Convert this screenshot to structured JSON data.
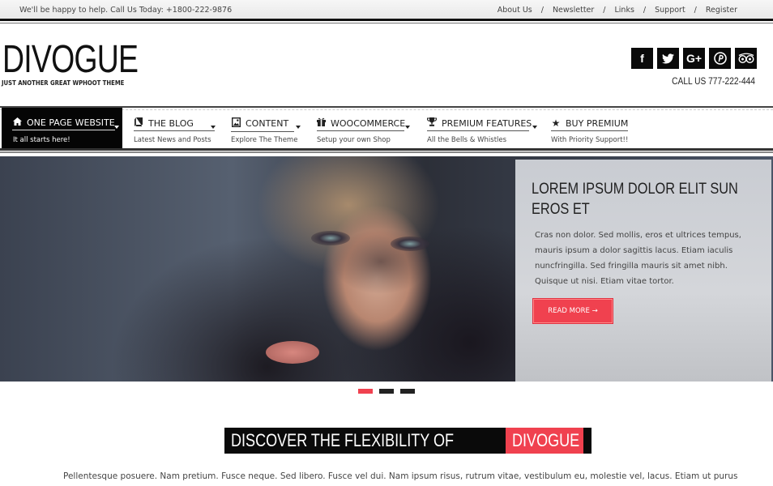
{
  "topbar": {
    "message": "We'll be happy to help. Call Us Today: +1800-222-9876",
    "links": [
      "About Us",
      "Newsletter",
      "Links",
      "Support",
      "Register"
    ],
    "separator": "/"
  },
  "header": {
    "logo": "DIVOGUE",
    "tagline": "JUST ANOTHER GREAT WPHOOT THEME",
    "social": [
      {
        "name": "facebook-icon",
        "glyph": "f"
      },
      {
        "name": "twitter-icon",
        "glyph": "🐦"
      },
      {
        "name": "google-plus-icon",
        "glyph": "G+"
      },
      {
        "name": "pinterest-icon",
        "glyph": "℗"
      },
      {
        "name": "tripadvisor-icon",
        "glyph": "oo"
      }
    ],
    "call_us": "CALL US 777-222-444"
  },
  "nav": {
    "items": [
      {
        "icon": "⌂",
        "title": "ONE PAGE WEBSITE",
        "subtitle": "It all starts here!",
        "active": true
      },
      {
        "icon": "▰",
        "title": "THE BLOG",
        "subtitle": "Latest News and Posts",
        "active": false
      },
      {
        "icon": "▣",
        "title": "CONTENT",
        "subtitle": "Explore The Theme",
        "active": false
      },
      {
        "icon": "⌂",
        "title": "WOOCOMMERCE",
        "subtitle": "Setup your own Shop",
        "active": false
      },
      {
        "icon": "♛",
        "title": "PREMIUM FEATURES",
        "subtitle": "All the Bells & Whistles",
        "active": false
      },
      {
        "icon": "★",
        "title": "BUY PREMIUM",
        "subtitle": "With Priority Support!!",
        "active": false
      }
    ]
  },
  "hero": {
    "title": "LOREM IPSUM DOLOR ELIT SUN EROS ET",
    "text": "Cras non dolor. Sed mollis, eros et ultrices tempus, mauris ipsum a dolor sagittis lacus. Etiam iaculis nuncfringilla. Sed fringilla mauris sit amet nibh. Quisque ut nisi. Etiam vitae tortor.",
    "button": "READ MORE →",
    "slides": 3,
    "active_slide": 1
  },
  "discover": {
    "prefix": "DISCOVER THE FLEXIBILITY OF",
    "highlight": "DIVOGUE",
    "intro": "Pellentesque posuere. Nam pretium. Fusce neque. Sed libero. Fusce vel dui. Nam ipsum risus, rutrum vitae, vestibulum eu, molestie vel, lacus. Etiam ut purus"
  },
  "colors": {
    "accent": "#f0414f",
    "dark": "#0a0a0a"
  }
}
